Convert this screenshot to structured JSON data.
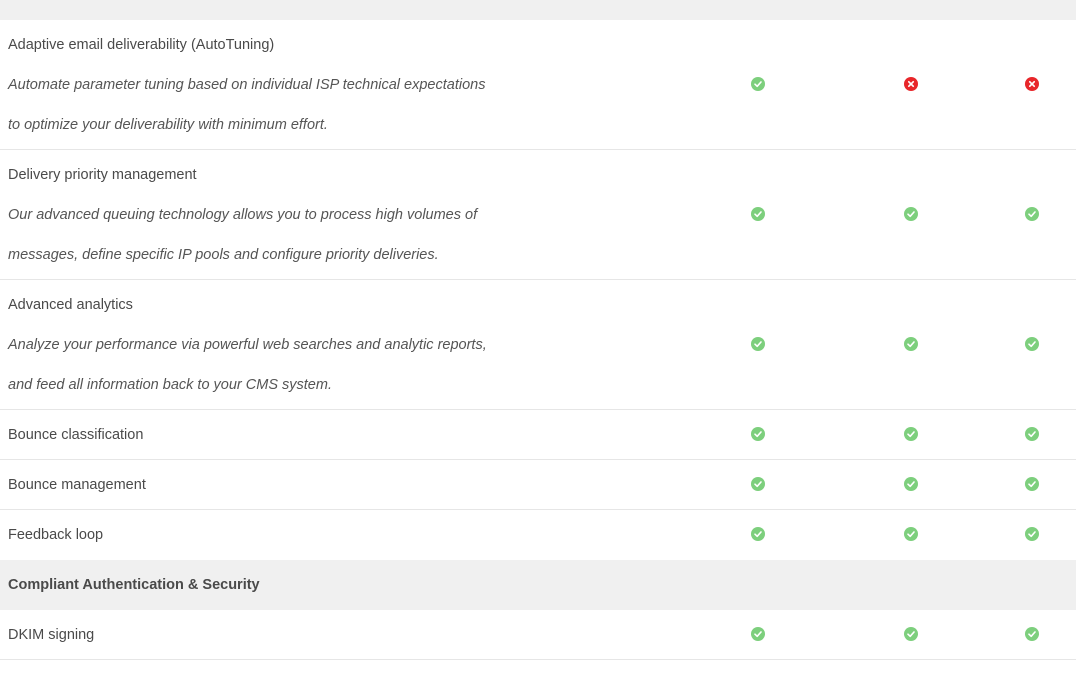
{
  "colors": {
    "check": "#7dcf7d",
    "cross": "#e8262a",
    "section_band": "#f0f0f0"
  },
  "rows": [
    {
      "title": "Adaptive email deliverability (AutoTuning)",
      "description_lines": [
        "Automate parameter tuning based on individual ISP technical expectations",
        "to optimize your deliverability with minimum effort."
      ],
      "cells": [
        "check-icon",
        "cross-icon",
        "cross-icon"
      ]
    },
    {
      "title": "Delivery priority management",
      "description_lines": [
        "Our advanced queuing technology allows you to process high volumes of",
        "messages, define specific IP pools and configure priority deliveries."
      ],
      "cells": [
        "check-icon",
        "check-icon",
        "check-icon"
      ]
    },
    {
      "title": "Advanced analytics",
      "description_lines": [
        "Analyze your performance via powerful web searches and analytic reports,",
        "and feed all information back to your CMS system."
      ],
      "cells": [
        "check-icon",
        "check-icon",
        "check-icon"
      ]
    },
    {
      "title": "Bounce classification",
      "cells": [
        "check-icon",
        "check-icon",
        "check-icon"
      ]
    },
    {
      "title": "Bounce management",
      "cells": [
        "check-icon",
        "check-icon",
        "check-icon"
      ]
    },
    {
      "title": "Feedback loop",
      "cells": [
        "check-icon",
        "check-icon",
        "check-icon"
      ]
    }
  ],
  "section": {
    "title": "Compliant Authentication & Security"
  },
  "section_rows": [
    {
      "title": "DKIM signing",
      "cells": [
        "check-icon",
        "check-icon",
        "check-icon"
      ]
    }
  ]
}
